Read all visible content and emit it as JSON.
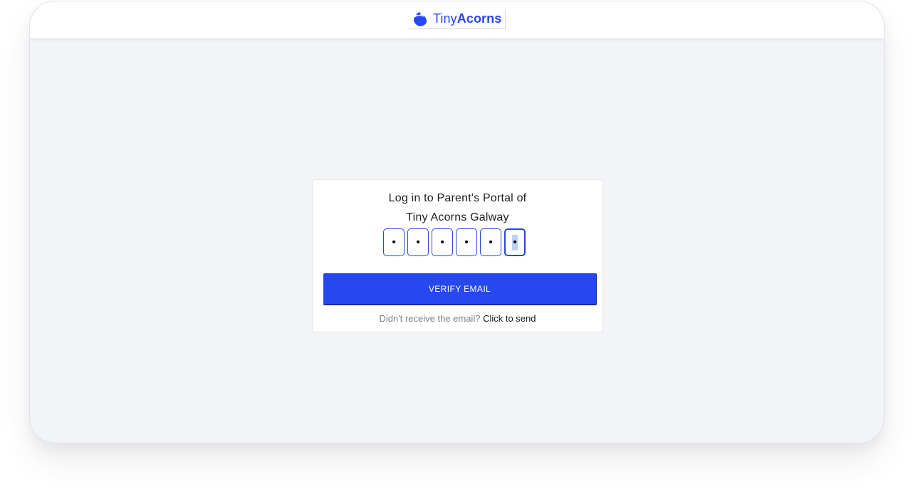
{
  "header": {
    "logo": {
      "icon": "acorn-icon",
      "name_light": "Tiny",
      "name_bold": "Acorns",
      "color": "#2747f0"
    }
  },
  "login": {
    "title_line1": "Log in to Parent's Portal of",
    "title_line2": "Tiny Acorns Galway",
    "otp": {
      "digits": [
        "•",
        "•",
        "•",
        "•",
        "•",
        "•"
      ],
      "active_index": 5
    },
    "verify_button": "VERIFY EMAIL",
    "resend_prompt": "Didn't receive the email?",
    "resend_link": "Click to send"
  },
  "colors": {
    "accent": "#2747f0",
    "background": "#f3f4f6",
    "card": "#ffffff"
  }
}
